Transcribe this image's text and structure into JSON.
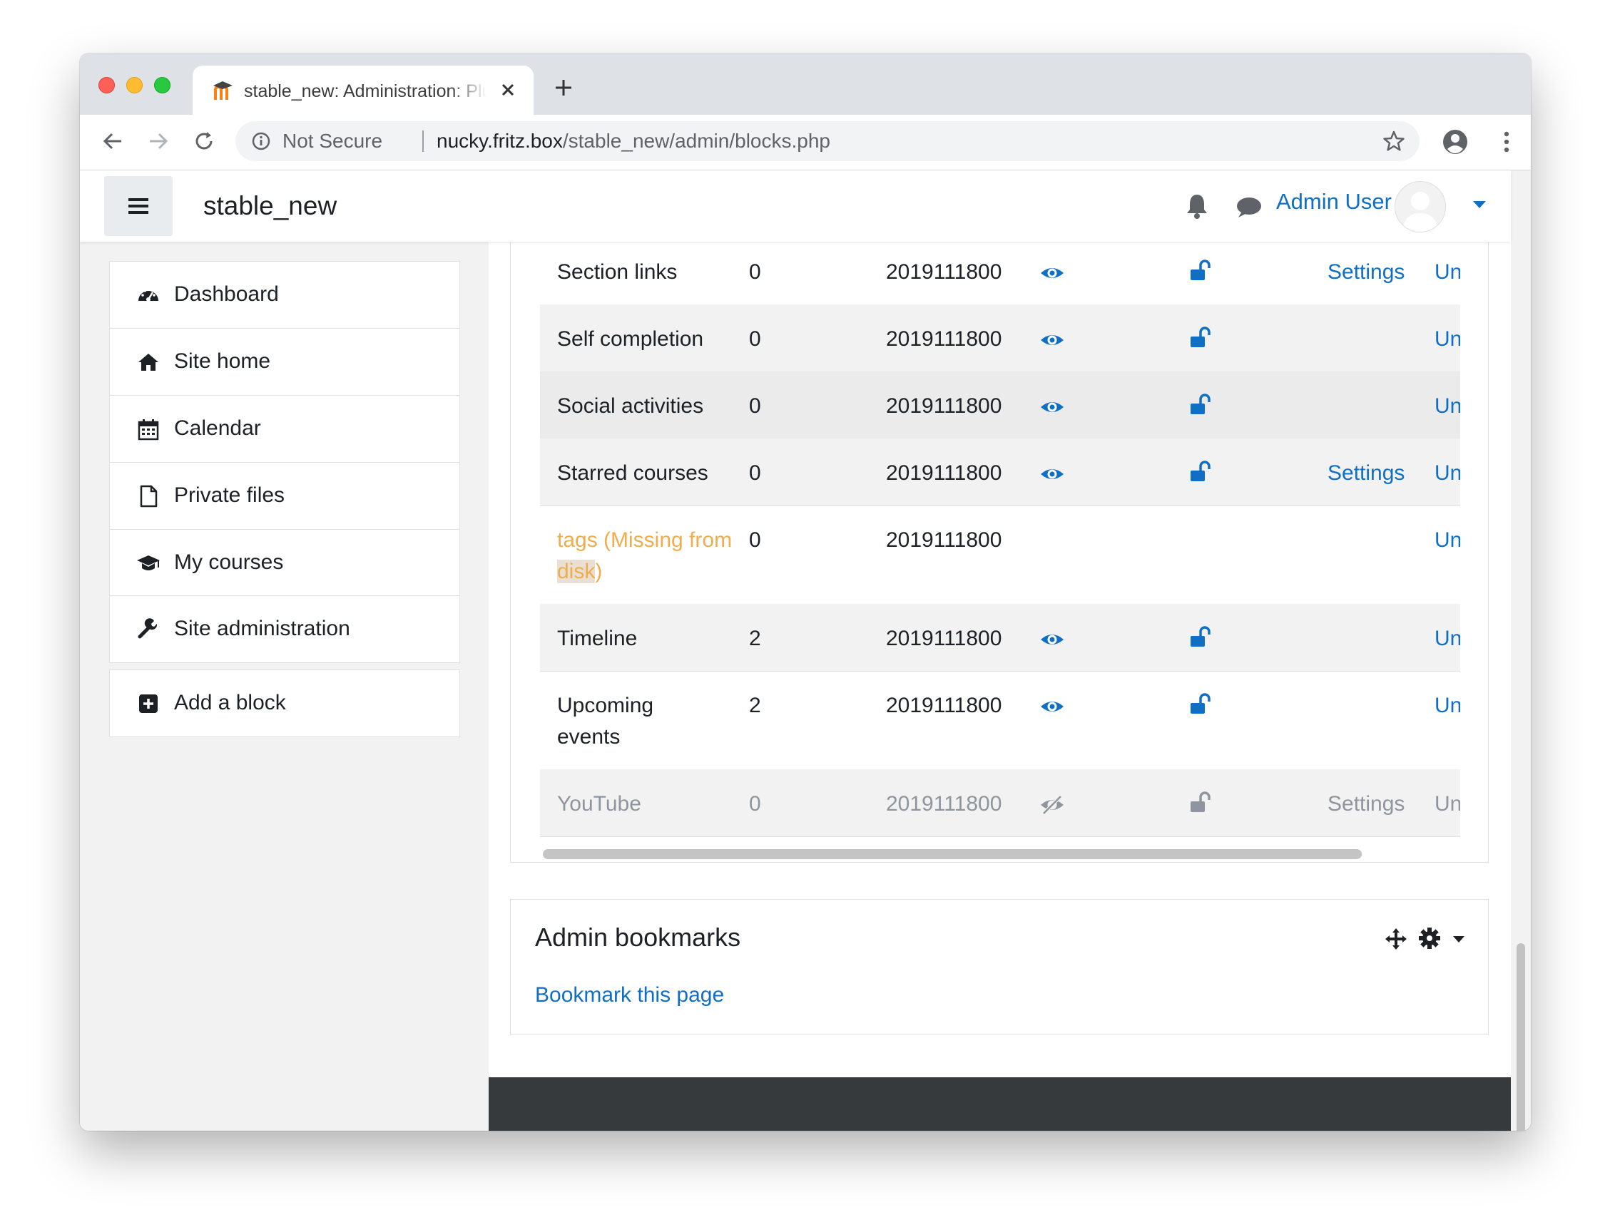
{
  "browser": {
    "tab_title": "stable_new: Administration: Plugins",
    "security_label": "Not Secure",
    "url_host": "nucky.fritz.box",
    "url_path": "/stable_new/admin/blocks.php"
  },
  "navbar": {
    "site_name": "stable_new",
    "user_name": "Admin User"
  },
  "sidebar": {
    "items": [
      {
        "label": "Dashboard",
        "icon": "dashboard-icon"
      },
      {
        "label": "Site home",
        "icon": "home-icon"
      },
      {
        "label": "Calendar",
        "icon": "calendar-icon"
      },
      {
        "label": "Private files",
        "icon": "file-icon"
      },
      {
        "label": "My courses",
        "icon": "graduation-cap-icon"
      }
    ],
    "admin": {
      "label": "Site administration",
      "icon": "wrench-icon"
    },
    "add_block": {
      "label": "Add a block",
      "icon": "plus-square-icon"
    }
  },
  "blocks_table": {
    "rows": [
      {
        "name": "Section links",
        "instances": "0",
        "version": "2019111800",
        "visible": true,
        "settings": "Settings",
        "uninstall": "Uninstall"
      },
      {
        "name": "Self completion",
        "instances": "0",
        "version": "2019111800",
        "visible": true,
        "settings": "",
        "uninstall": "Uninstall"
      },
      {
        "name": "Social activities",
        "instances": "0",
        "version": "2019111800",
        "visible": true,
        "settings": "",
        "uninstall": "Uninstall"
      },
      {
        "name": "Starred courses",
        "instances": "0",
        "version": "2019111800",
        "visible": true,
        "settings": "Settings",
        "uninstall": "Uninstall"
      },
      {
        "name_part1": "tags (Missing from ",
        "name_part2": "disk",
        "name_part3": ")",
        "instances": "0",
        "version": "2019111800",
        "missing": true,
        "uninstall": "Uninstall"
      },
      {
        "name": "Timeline",
        "instances": "2",
        "version": "2019111800",
        "visible": true,
        "settings": "",
        "uninstall": "Uninstall"
      },
      {
        "name": "Upcoming events",
        "instances": "2",
        "version": "2019111800",
        "visible": true,
        "settings": "",
        "uninstall": "Uninstall"
      },
      {
        "name": "YouTube",
        "instances": "0",
        "version": "2019111800",
        "visible": false,
        "settings": "Settings",
        "uninstall": "Uninstall"
      }
    ]
  },
  "admin_bookmarks": {
    "title": "Admin bookmarks",
    "link": "Bookmark this page"
  },
  "colors": {
    "link": "#0f6fc5",
    "missing": "#f0ad4e",
    "footer": "#373a3c"
  }
}
